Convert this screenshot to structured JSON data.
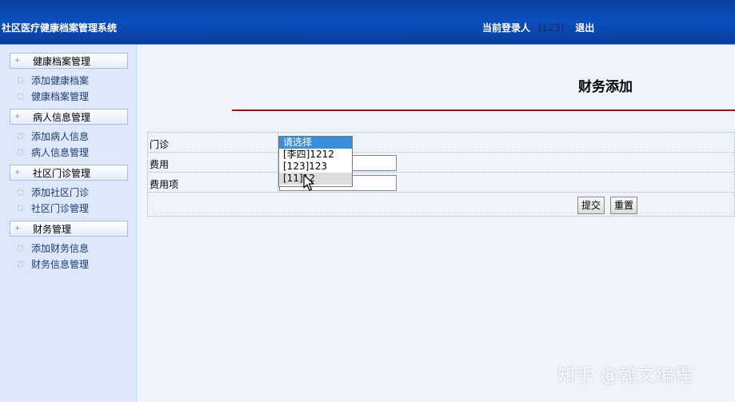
{
  "header": {
    "app_title": "社区医疗健康档案管理系统",
    "login_label": "当前登录人",
    "current_user": "[123]",
    "logout_label": "退出"
  },
  "sidebar": {
    "groups": [
      {
        "title": "健康档案管理",
        "links": [
          "添加健康档案",
          "健康档案管理"
        ]
      },
      {
        "title": "病人信息管理",
        "links": [
          "添加病人信息",
          "病人信息管理"
        ]
      },
      {
        "title": "社区门诊管理",
        "links": [
          "添加社区门诊",
          "社区门诊管理"
        ]
      },
      {
        "title": "财务管理",
        "links": [
          "添加财务信息",
          "财务信息管理"
        ]
      }
    ]
  },
  "main": {
    "page_title": "财务添加",
    "form": {
      "fields": [
        {
          "label": "门诊"
        },
        {
          "label": "费用",
          "value": ""
        },
        {
          "label": "费用项",
          "value": ""
        }
      ],
      "submit_label": "提交",
      "reset_label": "重置"
    },
    "dropdown": {
      "options": [
        "请选择",
        "[李四]1212",
        "[123]123",
        "[11]12"
      ],
      "selected_index": 0,
      "hover_index": 3
    }
  },
  "watermark": "知乎 @翰文编程",
  "colors": {
    "header_blue": "#0a4fc0",
    "divider_red": "#8b1a1a",
    "selected_option": "#3a8fdc"
  }
}
